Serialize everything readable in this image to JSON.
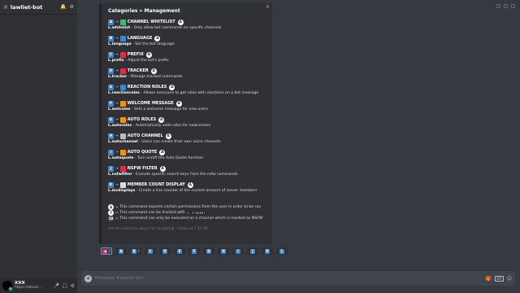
{
  "sidebar": {
    "server_name": "lawliet-bot",
    "header_icons": [
      "bell-icon",
      "gear-icon"
    ],
    "user": {
      "name": "XXX",
      "status": "https://discor...",
      "controls": [
        "mic-icon",
        "headphones-icon",
        "gear-icon"
      ]
    }
  },
  "top_icons": [
    "toolbar-icon-1",
    "toolbar-icon-2",
    "toolbar-icon-3",
    "toolbar-icon-4"
  ],
  "embed": {
    "title": "Categories » Management",
    "close": "×",
    "sections": [
      {
        "letter": "A",
        "arrow": "→",
        "emoji_color": "#43b581",
        "title": "CHANNEL WHITELIST",
        "tag": "A",
        "cmd": "L.whitelist",
        "desc": " - Only allow bot commands on specific channels"
      },
      {
        "letter": "B",
        "arrow": "→",
        "emoji_color": "#3a86c8",
        "title": "LANGUAGE",
        "tag": "A",
        "cmd": "L.language",
        "desc": " - Set the bot language"
      },
      {
        "letter": "C",
        "arrow": "→",
        "emoji_color": "#dd2e44",
        "title": "PREFIX",
        "tag": "A",
        "cmd": "L.prefix",
        "desc": " - Adjust the bot's prefix"
      },
      {
        "letter": "D",
        "arrow": "→",
        "emoji_color": "#dd2e44",
        "title": "TRACKER",
        "tag": "A",
        "cmd": "L.tracker",
        "desc": " - Manage tracked commands"
      },
      {
        "letter": "E",
        "arrow": "→",
        "emoji_color": "#3a86c8",
        "title": "REACTION ROLES",
        "tag": "A",
        "cmd": "L.reactionroles",
        "desc": " - Allows everyone to get roles with reactions on a bot message"
      },
      {
        "letter": "F",
        "arrow": "→",
        "emoji_color": "#f4900c",
        "title": "WELCOME MESSAGE",
        "tag": "A",
        "cmd": "L.welcome",
        "desc": " - Sets a welcome message for new users"
      },
      {
        "letter": "G",
        "arrow": "→",
        "emoji_color": "#f4900c",
        "title": "AUTO ROLES",
        "tag": "A",
        "cmd": "L.autoroles",
        "desc": " - Automatically adds roles for newcomers"
      },
      {
        "letter": "H",
        "arrow": "→",
        "emoji_color": "#b9bbbe",
        "title": "AUTO CHANNEL",
        "tag": "A",
        "cmd": "L.autochannel",
        "desc": " - Users can create their own voice channels"
      },
      {
        "letter": "I",
        "arrow": "→",
        "emoji_color": "#f4900c",
        "title": "AUTO QUOTE",
        "tag": "A",
        "cmd": "L.autoquote",
        "desc": " - Turn on/off the Auto Quote function"
      },
      {
        "letter": "J",
        "arrow": "→",
        "emoji_color": "#dd2e44",
        "title": "NSFW FILTER",
        "tag": "A",
        "cmd": "L.nsfwfilter",
        "desc": " - Exclude specific search keys from the nsfw commands"
      },
      {
        "letter": "K",
        "arrow": "→",
        "emoji_color": "#dcddde",
        "title": "MEMBER COUNT DISPLAY",
        "tag": "A",
        "cmd": "L.mcdisplays",
        "desc": " - Create a live counter of the current amount of server members"
      }
    ],
    "legend": [
      {
        "badge": "A",
        "text": "= This command expects certain permissions from the user in order to be run"
      },
      {
        "badge": "T",
        "text": "= This command can be tracked with ",
        "code": "L.tracker"
      },
      {
        "badge": "18",
        "text": "= This command can only be executed on a channel which is marked as NSFW"
      }
    ],
    "footer": "Use the reactions above for navigating • Today at 7:16 PM"
  },
  "reactions": [
    {
      "label": "◀",
      "count": "2",
      "active": true
    },
    {
      "label": "A",
      "count": ""
    },
    {
      "label": "B",
      "count": "2"
    },
    {
      "label": "C",
      "count": ""
    },
    {
      "label": "D",
      "count": ""
    },
    {
      "label": "E",
      "count": ""
    },
    {
      "label": "F",
      "count": ""
    },
    {
      "label": "G",
      "count": ""
    },
    {
      "label": "H",
      "count": ""
    },
    {
      "label": "I",
      "count": ""
    },
    {
      "label": "J",
      "count": ""
    },
    {
      "label": "K",
      "count": ""
    },
    {
      "label": "L",
      "count": ""
    }
  ],
  "composer": {
    "placeholder": "Message #lawliet-bot",
    "icons": [
      "gift-icon",
      "gif-icon",
      "emoji-icon"
    ],
    "gif_label": "GIF"
  }
}
